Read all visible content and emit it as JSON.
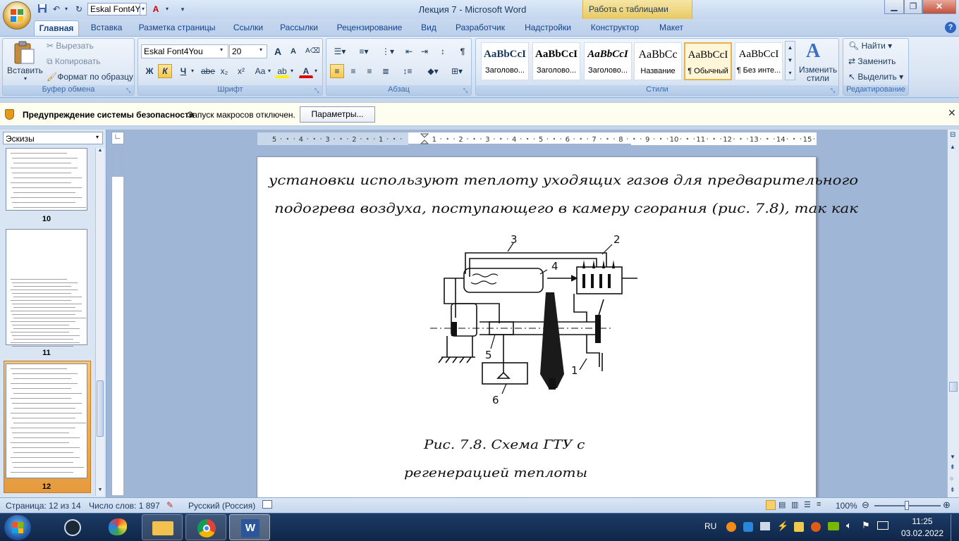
{
  "window": {
    "title": "Лекция 7 - Microsoft Word",
    "context_tab": "Работа с таблицами",
    "quick_access_font": "Eskal Font4Yo"
  },
  "tabs": [
    "Главная",
    "Вставка",
    "Разметка страницы",
    "Ссылки",
    "Рассылки",
    "Рецензирование",
    "Вид",
    "Разработчик",
    "Надстройки",
    "Конструктор",
    "Макет"
  ],
  "ribbon": {
    "clipboard": {
      "title": "Буфер обмена",
      "paste": "Вставить",
      "cut": "Вырезать",
      "copy": "Копировать",
      "format_painter": "Формат по образцу"
    },
    "font": {
      "title": "Шрифт",
      "name": "Eskal Font4You",
      "size": "20",
      "bold": "Ж",
      "italic": "К",
      "underline": "Ч",
      "strike": "abe",
      "sub": "x₂",
      "sup": "x²",
      "case": "Aa",
      "grow": "A",
      "shrink": "A",
      "highlight": "ab",
      "color": "A"
    },
    "paragraph": {
      "title": "Абзац"
    },
    "styles": {
      "title": "Стили",
      "items": [
        {
          "sample": "AaBbCcI",
          "name": "Заголово..."
        },
        {
          "sample": "AaBbCcI",
          "name": "Заголово..."
        },
        {
          "sample": "AaBbCcI",
          "name": "Заголово..."
        },
        {
          "sample": "AaBbCc",
          "name": "Название"
        },
        {
          "sample": "AaBbCcI",
          "name": "¶ Обычный"
        },
        {
          "sample": "AaBbCcI",
          "name": "¶ Без инте..."
        }
      ],
      "change": "Изменить стили"
    },
    "editing": {
      "title": "Редактирование",
      "find": "Найти",
      "replace": "Заменить",
      "select": "Выделить"
    }
  },
  "security": {
    "title": "Предупреждение системы безопасности",
    "message": "Запуск макросов отключен.",
    "button": "Параметры..."
  },
  "nav": {
    "select": "Эскизы",
    "pages": [
      "10",
      "11",
      "12"
    ]
  },
  "ruler": {
    "marks": [
      "5",
      "4",
      "3",
      "2",
      "1",
      "1",
      "2",
      "3",
      "4",
      "5",
      "6",
      "7",
      "8",
      "9",
      "10",
      "11",
      "12",
      "13",
      "14",
      "15"
    ]
  },
  "document": {
    "line1": "установки используют теплоту уходящих газов для предварительного",
    "line2": "подогрева воздуха, поступающего в камеру сгорания (рис. 7.8), так как",
    "fig_labels": [
      "3",
      "2",
      "4",
      "5",
      "1",
      "6"
    ],
    "caption1": "Рис. 7.8. Схема ГТУ с",
    "caption2": "регенерацией теплоты"
  },
  "status": {
    "page": "Страница: 12 из 14",
    "words": "Число слов: 1 897",
    "lang": "Русский (Россия)",
    "zoom": "100%"
  },
  "taskbar": {
    "lang": "RU",
    "time": "11:25",
    "date": "03.02.2022"
  }
}
